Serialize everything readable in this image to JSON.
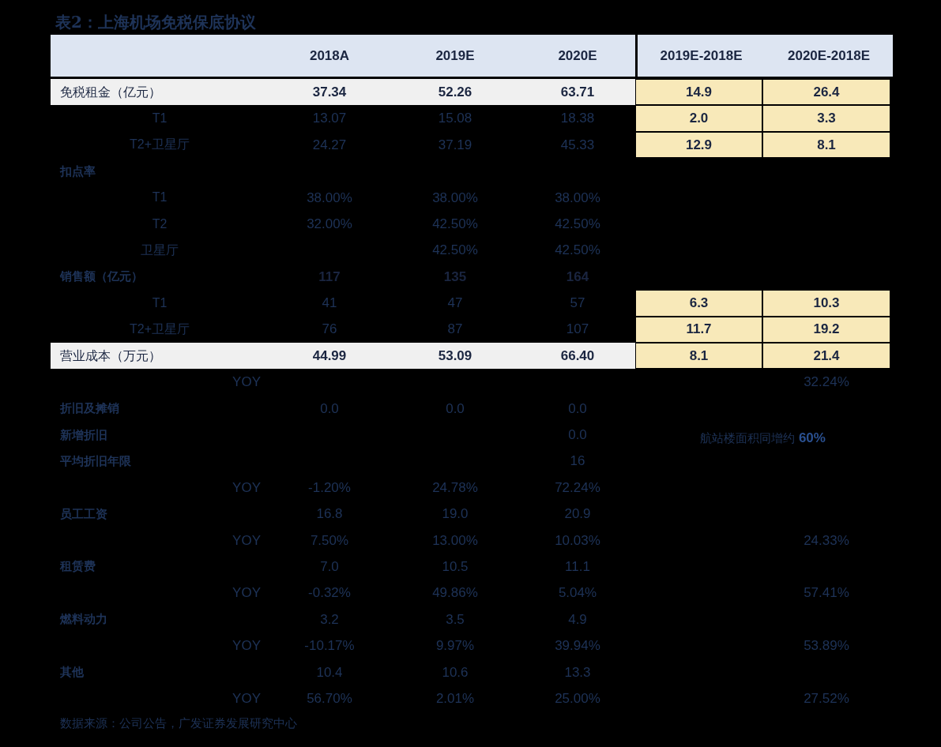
{
  "title": "表2：上海机场免税保底协议",
  "table": {
    "columns": [
      "2018A",
      "2019E",
      "2020E"
    ],
    "diff_columns": [
      "2019E-2018E",
      "2020E-2018E"
    ],
    "rows": [
      {
        "kind": "highlight",
        "label": "免税租金（亿元）",
        "y2018a": "37.34",
        "y2019e": "52.26",
        "y2020e": "63.71",
        "diff_2019e": {
          "text": "14.9",
          "highlighted": true
        },
        "diff_2020e": {
          "text": "26.4",
          "highlighted": true
        }
      },
      {
        "kind": "sub",
        "label": "T1",
        "y2018a": "13.07",
        "y2019e": "15.08",
        "y2020e": "18.38",
        "diff_2019e": {
          "text": "2.0",
          "highlighted": true
        },
        "diff_2020e": {
          "text": "3.3",
          "highlighted": true
        }
      },
      {
        "kind": "sub",
        "label": "T2+卫星厅",
        "y2018a": "24.27",
        "y2019e": "37.19",
        "y2020e": "45.33",
        "diff_2019e": {
          "text": "12.9",
          "highlighted": true
        },
        "diff_2020e": {
          "text": "8.1",
          "highlighted": true
        }
      },
      {
        "kind": "group",
        "label": "扣点率"
      },
      {
        "kind": "sub",
        "label": "T1",
        "y2018a": "38.00%",
        "y2019e": "38.00%",
        "y2020e": "38.00%"
      },
      {
        "kind": "sub",
        "label": "T2",
        "y2018a": "32.00%",
        "y2019e": "42.50%",
        "y2020e": "42.50%"
      },
      {
        "kind": "sub",
        "label": "卫星厅",
        "y2019e": "42.50%",
        "y2020e": "42.50%"
      },
      {
        "kind": "total",
        "label": "销售额（亿元）",
        "y2018a": "117",
        "y2019e": "135",
        "y2020e": "164"
      },
      {
        "kind": "sub",
        "label": "T1",
        "y2018a": "41",
        "y2019e": "47",
        "y2020e": "57",
        "diff_2019e": {
          "text": "6.3",
          "highlighted": true
        },
        "diff_2020e": {
          "text": "10.3",
          "highlighted": true
        }
      },
      {
        "kind": "sub",
        "label": "T2+卫星厅",
        "y2018a": "76",
        "y2019e": "87",
        "y2020e": "107",
        "diff_2019e": {
          "text": "11.7",
          "highlighted": true
        },
        "diff_2020e": {
          "text": "19.2",
          "highlighted": true
        }
      },
      {
        "kind": "highlight",
        "label": "营业成本（万元）",
        "y2018a": "44.99",
        "y2019e": "53.09",
        "y2020e": "66.40",
        "diff_2019e": {
          "text": "8.1",
          "highlighted": true
        },
        "diff_2020e": {
          "text": "21.4",
          "highlighted": true
        }
      },
      {
        "kind": "yoy",
        "label": "YOY",
        "diff_2020e": {
          "text": "32.24%",
          "highlighted": false
        }
      },
      {
        "kind": "group",
        "label": "折旧及摊销",
        "y2018a": "0.0",
        "y2019e": "0.0",
        "y2020e": "0.0"
      },
      {
        "kind": "group",
        "label": "新增折旧",
        "y2020e": "0.0",
        "note": "航站楼面积同增约 **60%**"
      },
      {
        "kind": "group",
        "label": "平均折旧年限",
        "y2020e": "16"
      },
      {
        "kind": "yoy",
        "label": "YOY",
        "y2018a": "-1.20%",
        "y2019e": "24.78%",
        "y2020e": "72.24%"
      },
      {
        "kind": "group",
        "label": "员工工资",
        "y2018a": "16.8",
        "y2019e": "19.0",
        "y2020e": "20.9"
      },
      {
        "kind": "yoy",
        "label": "YOY",
        "y2018a": "7.50%",
        "y2019e": "13.00%",
        "y2020e": "10.03%",
        "diff_2020e": {
          "text": "24.33%",
          "highlighted": false
        }
      },
      {
        "kind": "group",
        "label": "租赁费",
        "y2018a": "7.0",
        "y2019e": "10.5",
        "y2020e": "11.1"
      },
      {
        "kind": "yoy",
        "label": "YOY",
        "y2018a": "-0.32%",
        "y2019e": "49.86%",
        "y2020e": "5.04%",
        "diff_2020e": {
          "text": "57.41%",
          "highlighted": false
        }
      },
      {
        "kind": "group",
        "label": "燃料动力",
        "y2018a": "3.2",
        "y2019e": "3.5",
        "y2020e": "4.9"
      },
      {
        "kind": "yoy",
        "label": "YOY",
        "y2018a": "-10.17%",
        "y2019e": "9.97%",
        "y2020e": "39.94%",
        "diff_2020e": {
          "text": "53.89%",
          "highlighted": false
        }
      },
      {
        "kind": "group",
        "label": "其他",
        "y2018a": "10.4",
        "y2019e": "10.6",
        "y2020e": "13.3"
      },
      {
        "kind": "yoy",
        "label": "YOY",
        "y2018a": "56.70%",
        "y2019e": "2.01%",
        "y2020e": "25.00%",
        "diff_2020e": {
          "text": "27.52%",
          "highlighted": false
        }
      }
    ]
  },
  "source": "数据来源：公司公告，广发证券发展研究中心"
}
